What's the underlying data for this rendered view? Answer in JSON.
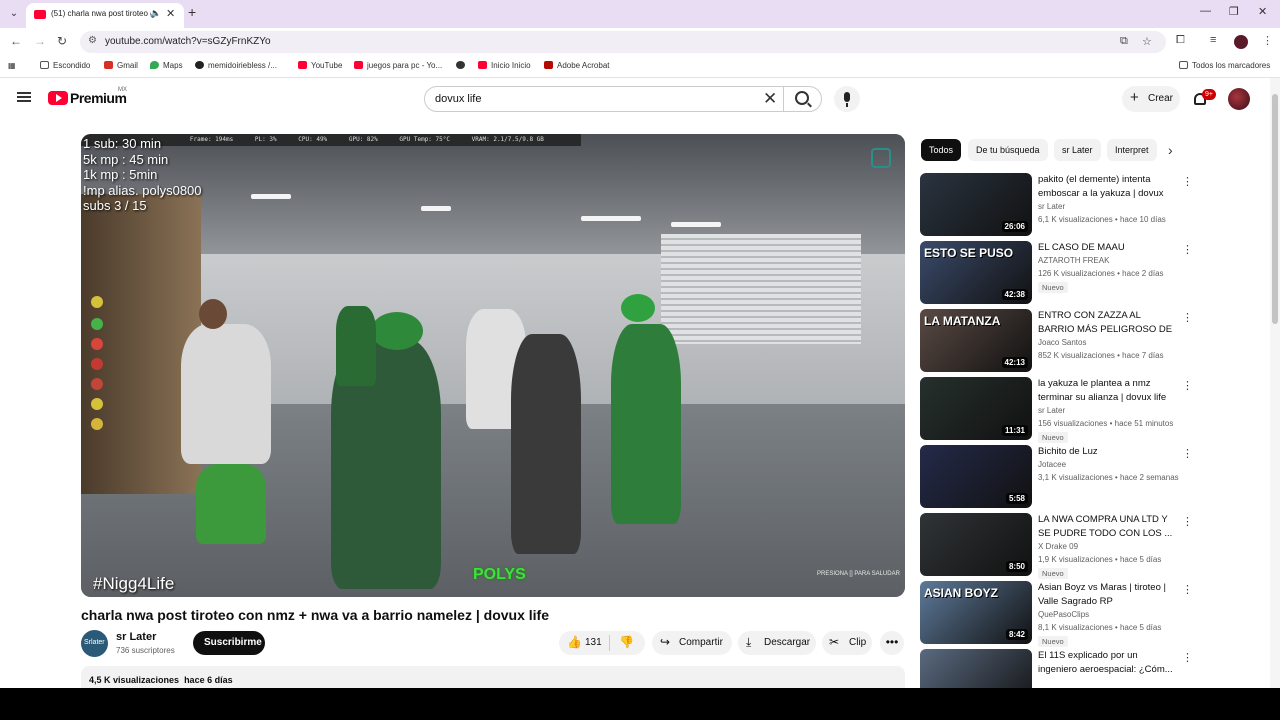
{
  "browser": {
    "tab_title": "(51) charla nwa post tiroteo c",
    "url": "youtube.com/watch?v=sGZyFrnKZYo",
    "bookmarks": [
      "Escondido",
      "Gmail",
      "Maps",
      "memidoiriebless /...",
      "YouTube",
      "juegos para pc - Yo...",
      "",
      "Inicio Inicio",
      "Adobe Acrobat"
    ],
    "all_bookmarks": "Todos los marcadores"
  },
  "masthead": {
    "brand": "Premium",
    "region": "MX",
    "search_query": "dovux life",
    "create_label": "Crear",
    "notifications": "9+"
  },
  "video": {
    "hud": "VRAM: 2.1/7.5/9.8 GB",
    "hud_full": "        Frame: 194ms      PL: 3%      CPU: 49%      GPU: 82%      GPU Temp: 75°C      VRAM: 2.1/7.5/9.8 GB",
    "overlay": [
      "1 sub: 30 min",
      "5k mp : 45 min",
      "1k mp :  5min",
      "!mp alias. polys0800",
      "subs 3 / 15"
    ],
    "hashtag": "#Nigg4Life",
    "green_tag": "POLYS",
    "watermark": "PRESIONA [] PARA SALUDAR"
  },
  "title": "charla nwa post tiroteo con nmz + nwa va a barrio namelez | dovux life",
  "channel": {
    "avatar_text": "Srlater",
    "name": "sr Later",
    "subscribers": "736 suscriptores",
    "subscribe_label": "Suscribirme"
  },
  "actions": {
    "likes": "131",
    "share": "Compartir",
    "download": "Descargar",
    "clip": "Clip"
  },
  "description": {
    "views": "4,5 K visualizaciones",
    "date": "hace 6 días"
  },
  "chips": [
    "Todos",
    "De tu búsqueda",
    "sr Later",
    "Interpret"
  ],
  "recommendations": [
    {
      "title": "pakito (el demente) intenta emboscar a la yakuza | dovux ...",
      "channel": "sr Later",
      "stats": "6,1 K visualizaciones • hace 10 días",
      "duration": "26:06",
      "badge": "",
      "thumb": "",
      "color": "#2a3440"
    },
    {
      "title": "EL CASO DE MAAU",
      "channel": "AZTAROTH FREAK",
      "stats": "126 K visualizaciones • hace 2 días",
      "duration": "42:38",
      "badge": "Nuevo",
      "thumb": "ESTO SE PUSO",
      "color": "#3a4b6a"
    },
    {
      "title": "ENTRO CON ZAZZA AL BARRIO MÁS PELIGROSO DE LA ...",
      "channel": "Joaco Santos",
      "stats": "852 K visualizaciones • hace 7 días",
      "duration": "42:13",
      "badge": "",
      "thumb": "LA MATANZA",
      "color": "#5a4a44"
    },
    {
      "title": "la yakuza  le plantea a nmz terminar su alianza | dovux life",
      "channel": "sr Later",
      "stats": "156 visualizaciones • hace 51 minutos",
      "duration": "11:31",
      "badge": "Nuevo",
      "thumb": "",
      "color": "#26302c"
    },
    {
      "title": "Bichito de Luz",
      "channel": "Jotacee",
      "stats": "3,1 K visualizaciones • hace 2 semanas",
      "duration": "5:58",
      "badge": "",
      "thumb": "",
      "color": "#242a4a"
    },
    {
      "title": "LA NWA COMPRA UNA LTD Y SE PUDRE TODO CON LOS ...",
      "channel": "X Drake 09",
      "stats": "1,9 K visualizaciones • hace 5 días",
      "duration": "8:50",
      "badge": "Nuevo",
      "thumb": "",
      "color": "#2f3436"
    },
    {
      "title": "Asian Boyz vs Maras | tiroteo | Valle Sagrado RP",
      "channel": "QuePasoClips",
      "stats": "8,1 K visualizaciones • hace 5 días",
      "duration": "8:42",
      "badge": "Nuevo",
      "thumb": "ASIAN BOYZ",
      "color": "#5d7a9a"
    },
    {
      "title": "El 11S explicado por un ingeniero aeroespacial: ¿Cóm...",
      "channel": "",
      "stats": "",
      "duration": "",
      "badge": "",
      "thumb": "",
      "color": "#5a6a80"
    }
  ],
  "colors": {
    "accent_red": "#ff0033",
    "tabstrip": "#e9ddf4",
    "green_tag": "#3de23a"
  }
}
